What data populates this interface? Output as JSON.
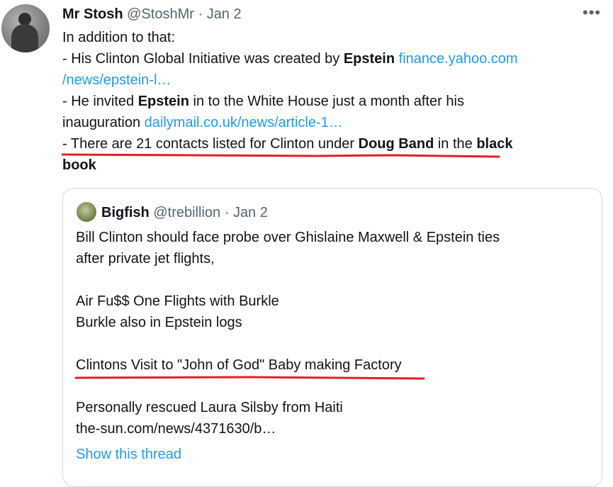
{
  "tweet": {
    "display_name": "Mr Stosh",
    "handle": "@StoshMr",
    "sep": "·",
    "date": "Jan 2",
    "more_label": "•••",
    "line1": "In addition to that:",
    "line2_a": "- His Clinton Global Initiative was created by ",
    "line2_b": "Epstein",
    "line2_link": "finance.yahoo.com",
    "line3_link": "/news/epstein-l…",
    "line4_a": "- He invited ",
    "line4_b": "Epstein",
    "line4_c": " in to the White House just a month after his",
    "line5_a": "inauguration ",
    "line5_link": "dailymail.co.uk/news/article-1…",
    "line6_a": "- There are 21 contacts listed for Clinton under ",
    "line6_b": "Doug Band",
    "line6_c": " in the ",
    "line6_d": "black",
    "line7_b": "book"
  },
  "quote": {
    "display_name": "Bigfish",
    "handle": "@trebillion",
    "sep": "·",
    "date": "Jan 2",
    "l1": "Bill Clinton should face probe over Ghislaine Maxwell & Epstein ties",
    "l2": "after private jet flights,",
    "l3": "Air Fu$$ One Flights with Burkle",
    "l4": "Burkle also in Epstein logs",
    "l5": "Clintons Visit to \"John of God\" Baby making Factory",
    "l6": "Personally rescued Laura Silsby from Haiti",
    "l7": "the-sun.com/news/4371630/b…",
    "show_thread": "Show this thread"
  },
  "colors": {
    "link": "#1d9bf0",
    "muted": "#536471",
    "text": "#0f1419",
    "annotation": "#e0202a",
    "border": "#cfd9de"
  },
  "icons": {
    "avatar": "user-avatar-photo",
    "quote_avatar": "quoted-user-avatar-photo",
    "more": "more-options-icon"
  }
}
